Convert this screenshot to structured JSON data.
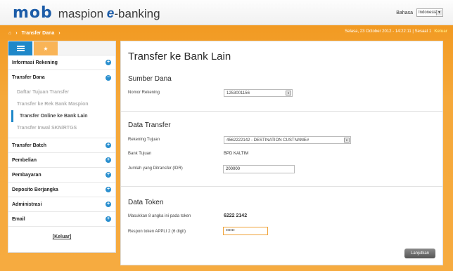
{
  "header": {
    "logo_mob": "mob",
    "logo_maspion": "maspion",
    "logo_e": "e",
    "logo_banking": "-banking",
    "lang_label": "Bahasa",
    "lang_value": "Indonesia"
  },
  "nav": {
    "crumb": "Transfer Dana",
    "status": "Selasa, 23 October 2012 - 14:22:11 | Sesaat 1",
    "logout": "Keluar"
  },
  "sidebar": {
    "menu": [
      {
        "label": "Informasi Rekening"
      },
      {
        "label": "Transfer Dana"
      }
    ],
    "sub_items": [
      {
        "label": "Daftar Tujuan Transfer"
      },
      {
        "label": "Transfer ke Rek Bank Maspion"
      },
      {
        "label": "Transfer Online ke Bank Lain"
      },
      {
        "label": "Transfer Inwal SKN/RTGS"
      }
    ],
    "menu_bottom": [
      {
        "label": "Transfer Batch"
      },
      {
        "label": "Pembelian"
      },
      {
        "label": "Pembayaran"
      },
      {
        "label": "Deposito Berjangka"
      },
      {
        "label": "Administrasi"
      },
      {
        "label": "Email"
      }
    ],
    "logout": "[Keluar]"
  },
  "main": {
    "title": "Transfer ke Bank Lain",
    "sumber": {
      "heading": "Sumber Dana",
      "label": "Nomor Rekening",
      "value": "1253001156"
    },
    "transfer": {
      "heading": "Data Transfer",
      "rek_label": "Rekening Tujuan",
      "rek_value": "4562222142 - DESTINATION CUSTNAME#",
      "bank_label": "Bank Tujuan",
      "bank_value": "BPD KALTIM",
      "amount_label": "Jumlah yang Ditransfer (IDR)",
      "amount_value": "200000"
    },
    "token": {
      "heading": "Data Token",
      "code_label": "Masukkan 8 angka ini pada token",
      "code_value": "6222 2142",
      "resp_label": "Respon token APPLI 2 (6 digit)",
      "resp_value": "••••••"
    },
    "next_label": "Lanjutkan"
  }
}
